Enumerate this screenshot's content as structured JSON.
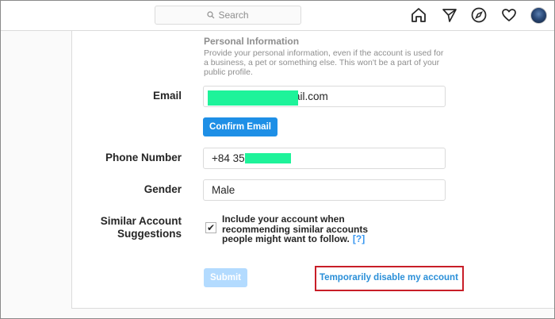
{
  "topbar": {
    "search_placeholder": "Search",
    "icons": [
      "home-icon",
      "direct-message-icon",
      "explore-compass-icon",
      "heart-activity-icon",
      "profile-avatar"
    ]
  },
  "form": {
    "section_title": "Personal Information",
    "section_desc": "Provide your personal information, even if the account is used for a business, a pet or something else. This won't be a part of your public profile.",
    "email": {
      "label": "Email",
      "value": "ail.com",
      "redacted": true
    },
    "confirm_email_label": "Confirm Email",
    "phone": {
      "label": "Phone Number",
      "value": "+84 35",
      "redacted": true
    },
    "gender": {
      "label": "Gender",
      "value": "Male"
    },
    "similar": {
      "label_line1": "Similar Account",
      "label_line2": "Suggestions",
      "checked": true,
      "check_mark": "✔",
      "text": "Include your account when recommending similar accounts people might want to follow.",
      "help": "[?]"
    },
    "submit_label": "Submit",
    "disable_link": "Temporarily disable my account"
  },
  "colors": {
    "primary_button": "#1e8fe6",
    "submit_disabled": "#b3dbff",
    "link": "#2a8fd8",
    "highlight_box": "#c81e28",
    "redaction": "#1ef39a"
  }
}
